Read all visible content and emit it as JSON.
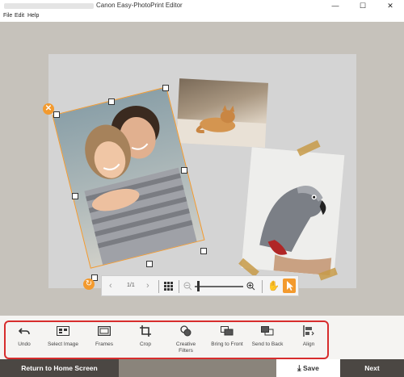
{
  "window": {
    "title": "Canon Easy-PhotoPrint Editor",
    "minimize": "—",
    "maximize": "☐",
    "close": "✕"
  },
  "menu": [
    "File",
    "Edit",
    "Help"
  ],
  "zoombar": {
    "prev_icon": "chevron-left-icon",
    "page_indicator": "1/1",
    "next_icon": "chevron-right-icon",
    "zoom_level": 0.12
  },
  "tools": [
    {
      "label": "Undo",
      "icon": "undo-icon"
    },
    {
      "label": "Select Image",
      "icon": "select-image-icon"
    },
    {
      "label": "Frames",
      "icon": "frames-icon"
    },
    {
      "label": "Crop",
      "icon": "crop-icon"
    },
    {
      "label": "Creative\nFilters",
      "icon": "creative-filters-icon"
    },
    {
      "label": "Bring to Front",
      "icon": "bring-to-front-icon"
    },
    {
      "label": "Send to Back",
      "icon": "send-to-back-icon"
    },
    {
      "label": "Align",
      "icon": "align-icon"
    }
  ],
  "footer": {
    "return_label": "Return to Home Screen",
    "save_label": "Save",
    "next_label": "Next"
  },
  "colors": {
    "accent": "#f39a2e",
    "highlight_frame": "#d72d2d",
    "workspace_bg": "#c6c2bb",
    "canvas_bg": "#d4d4d4"
  }
}
